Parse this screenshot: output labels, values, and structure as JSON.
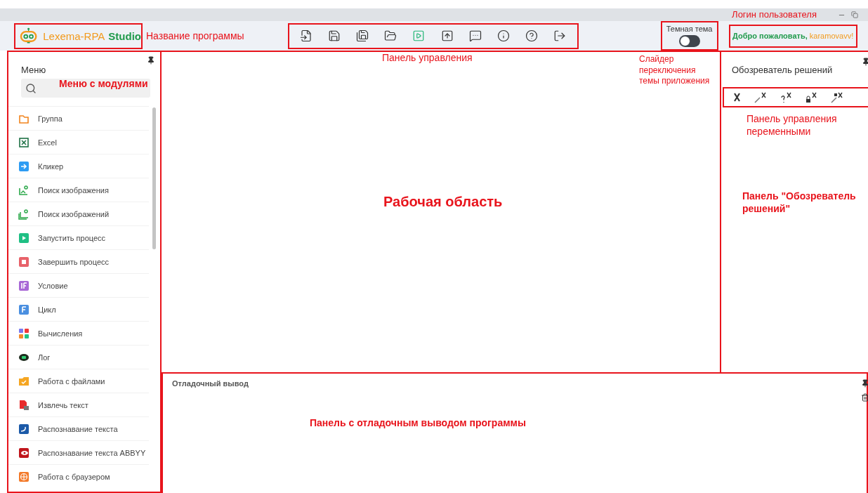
{
  "title_bar": {
    "note": "Логин пользователя"
  },
  "header": {
    "logo": {
      "first": "Lexema-RPA",
      "second": "Studio"
    },
    "logo_note": "Название программы",
    "toolbar_note": "Панель управления",
    "theme": {
      "label": "Темная тема",
      "on": false,
      "note": "Слайдер переключения темы приложения"
    },
    "welcome": {
      "greeting": "Добро пожаловать,",
      "user": "karamovavv!"
    }
  },
  "menu": {
    "title": "Меню",
    "note": "Меню с модулями",
    "items": [
      {
        "label": "Группа"
      },
      {
        "label": "Excel"
      },
      {
        "label": "Кликер"
      },
      {
        "label": "Поиск изображения"
      },
      {
        "label": "Поиск изображений"
      },
      {
        "label": "Запустить процесс"
      },
      {
        "label": "Завершить процесс"
      },
      {
        "label": "Условие"
      },
      {
        "label": "Цикл"
      },
      {
        "label": "Вычисления"
      },
      {
        "label": "Лог"
      },
      {
        "label": "Работа с файлами"
      },
      {
        "label": "Извлечь текст"
      },
      {
        "label": "Распознавание текста"
      },
      {
        "label": "Распознавание текста ABBYY"
      },
      {
        "label": "Работа с браузером"
      }
    ]
  },
  "workspace": {
    "note": "Рабочая область"
  },
  "solution_explorer": {
    "title": "Обозреватель решений",
    "toolbar_note": "Панель управления переменными",
    "note": "Панель \"Обозреватель решений\""
  },
  "debug_output": {
    "title": "Отладочный вывод",
    "note": "Панель с отладочным выводом программы"
  }
}
